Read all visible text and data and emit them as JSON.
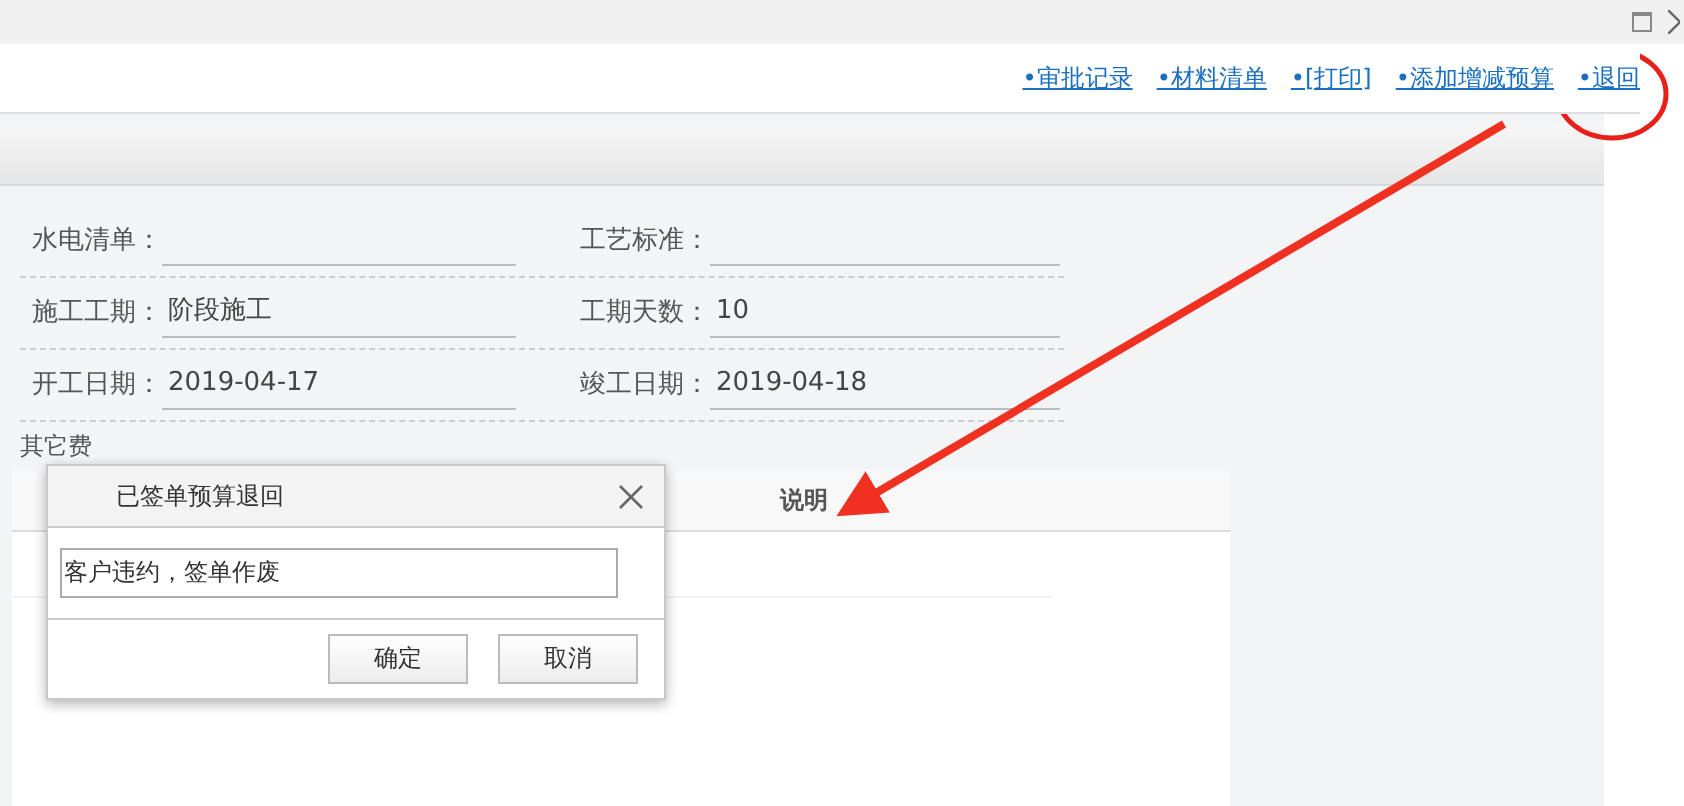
{
  "toolbar_links": [
    "•审批记录",
    "•材料清单",
    "•[打印]",
    "•添加增减预算",
    "•退回"
  ],
  "form_rows": [
    {
      "fields": [
        {
          "label": "水电清单："
        },
        {
          "label": "工艺标准："
        }
      ]
    },
    {
      "fields": [
        {
          "label": "施工工期：",
          "value": "阶段施工"
        },
        {
          "label": "工期天数：",
          "value": "10"
        }
      ]
    },
    {
      "fields": [
        {
          "label": "开工日期：",
          "value": "2019-04-17"
        },
        {
          "label": "竣工日期：",
          "value": "2019-04-18"
        }
      ]
    }
  ],
  "section_title": "其它费",
  "table": {
    "columns": [
      "说明"
    ]
  },
  "dialog": {
    "title": "已签单预算退回",
    "input": {
      "value": "客户违约，签单作废"
    },
    "buttons": [
      "确定",
      "取消"
    ]
  }
}
